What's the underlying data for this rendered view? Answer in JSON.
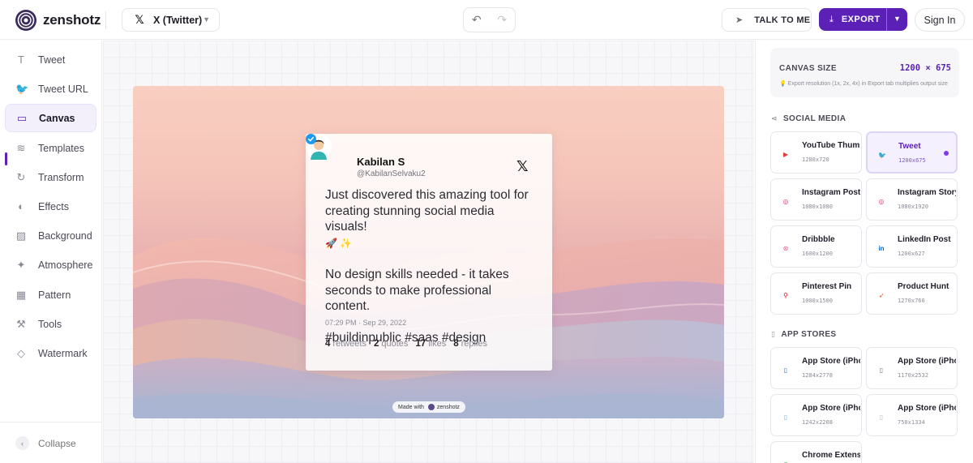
{
  "header": {
    "brand": "zenshotz",
    "platform_label": "X (Twitter)",
    "talk_label": "TALK TO ME",
    "export_label": "EXPORT",
    "signin_label": "Sign In"
  },
  "sidebar": {
    "items": [
      {
        "label": "Tweet",
        "icon": "text-icon"
      },
      {
        "label": "Tweet URL",
        "icon": "bird-icon"
      },
      {
        "label": "Canvas",
        "icon": "monitor-icon"
      },
      {
        "label": "Templates",
        "icon": "layers-icon"
      },
      {
        "label": "Transform",
        "icon": "rotate-icon"
      },
      {
        "label": "Effects",
        "icon": "palette-icon"
      },
      {
        "label": "Background",
        "icon": "image-icon"
      },
      {
        "label": "Atmosphere",
        "icon": "sparkle-icon"
      },
      {
        "label": "Pattern",
        "icon": "grid-icon"
      },
      {
        "label": "Tools",
        "icon": "wrench-icon"
      },
      {
        "label": "Watermark",
        "icon": "droplet-icon"
      }
    ],
    "active_index": 2,
    "collapse_label": "Collapse"
  },
  "tweet": {
    "name": "Kabilan S",
    "handle": "@KabilanSelvaku2",
    "line1": "Just discovered this amazing tool for creating stunning social media visuals!",
    "emojis": "🚀 ✨",
    "line2": "No design skills needed - it takes seconds to make professional content.",
    "line3": "#buildinpublic #saas #design",
    "timestamp": "07:29 PM · Sep 29, 2022",
    "retweets_count": "4",
    "retweets_label": "retweets",
    "quotes_count": "2",
    "quotes_label": "quotes",
    "likes_count": "17",
    "likes_label": "likes",
    "replies_count": "8",
    "replies_label": "replies"
  },
  "watermark": {
    "prefix": "Made with",
    "brand": "zenshotz"
  },
  "right_panel": {
    "canvas_size_title": "CANVAS SIZE",
    "canvas_size_value": "1200 × 675",
    "canvas_size_note": "Export resolution (1x, 2x, 4x) in Export tab multiplies output size",
    "social_title": "SOCIAL MEDIA",
    "social": [
      {
        "name": "YouTube Thumbnail",
        "dims": "1280x720",
        "color": "#e53935"
      },
      {
        "name": "Tweet",
        "dims": "1200x675",
        "color": "#1d9bf0",
        "selected": true
      },
      {
        "name": "Instagram Post",
        "dims": "1080x1080",
        "color": "#d62976"
      },
      {
        "name": "Instagram Story",
        "dims": "1080x1920",
        "color": "#d62976"
      },
      {
        "name": "Dribbble",
        "dims": "1600x1200",
        "color": "#ea4c89"
      },
      {
        "name": "LinkedIn Post",
        "dims": "1200x627",
        "color": "#0a66c2"
      },
      {
        "name": "Pinterest Pin",
        "dims": "1000x1500",
        "color": "#e60023"
      },
      {
        "name": "Product Hunt",
        "dims": "1270x760",
        "color": "#da552f"
      }
    ],
    "app_title": "APP STORES",
    "app": [
      {
        "name": "App Store (iPhone)",
        "dims": "1284x2778",
        "color": "#1a73e8"
      },
      {
        "name": "App Store (iPhone)",
        "dims": "1170x2532",
        "color": "#5f6b7a"
      },
      {
        "name": "App Store (iPhone)",
        "dims": "1242x2208",
        "color": "#64b5f6"
      },
      {
        "name": "App Store (iPhone)",
        "dims": "750x1334",
        "color": "#b0bec5"
      },
      {
        "name": "Chrome Extension",
        "dims": "",
        "color": "#34a853"
      }
    ]
  },
  "colors": {
    "accent": "#5b21b6"
  }
}
